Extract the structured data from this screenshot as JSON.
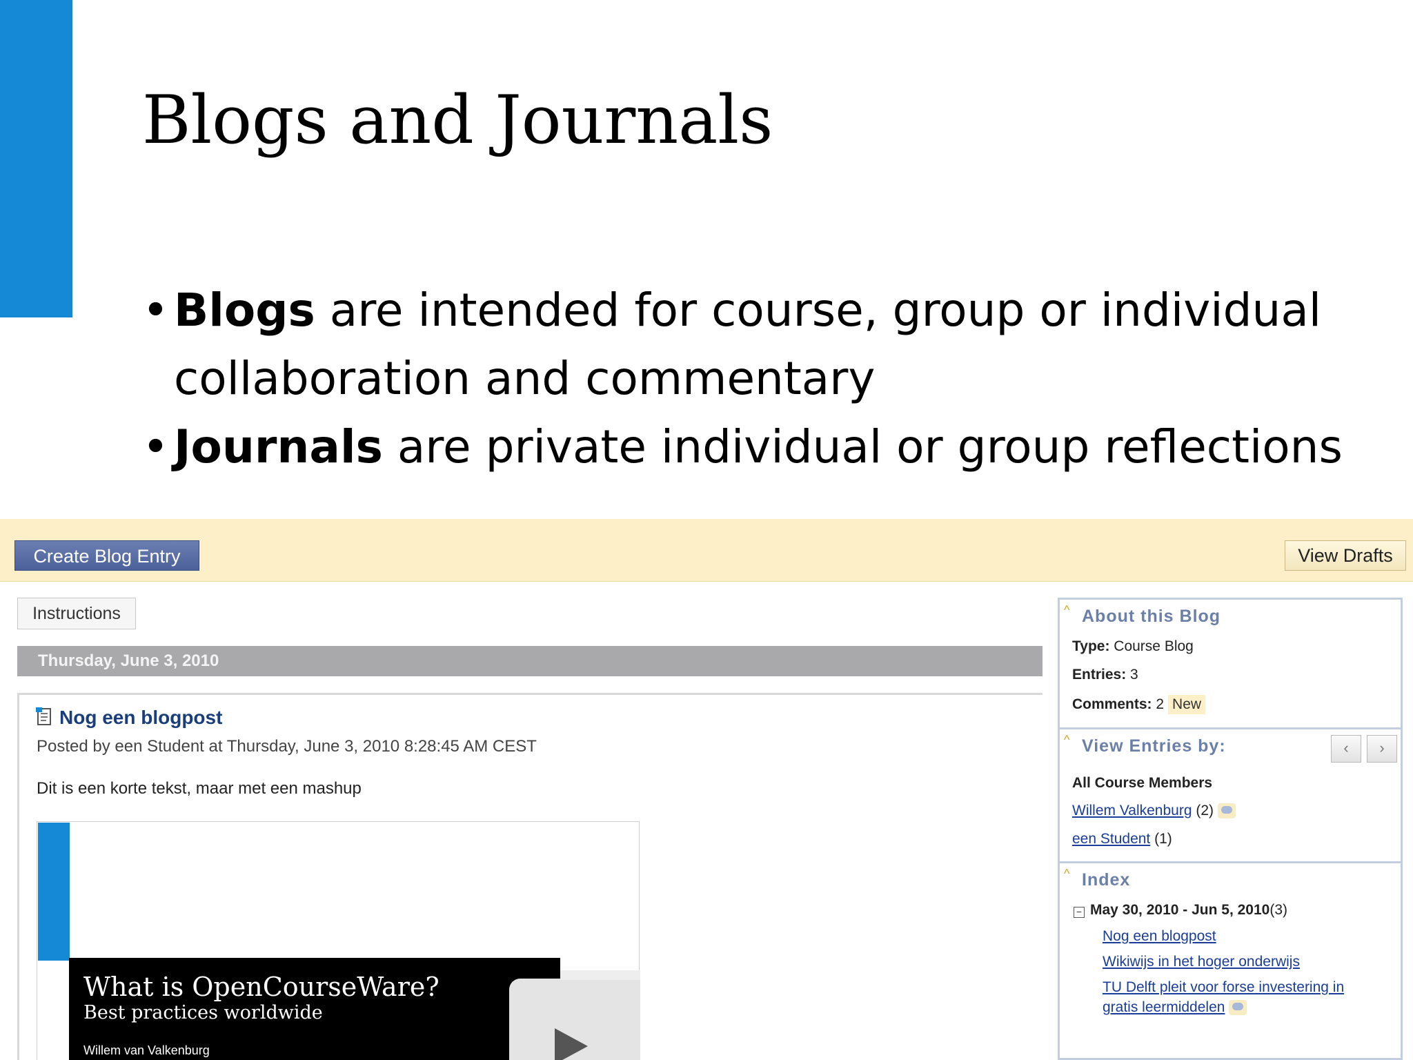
{
  "slide": {
    "title": "Blogs and Journals",
    "bullets": [
      {
        "term": "Blogs",
        "rest_line1": " are intended for course, group or individual",
        "rest_line2": "collaboration and commentary"
      },
      {
        "term": "Journals",
        "rest": " are private individual or group reflections"
      }
    ],
    "accent_color": "#1689d6"
  },
  "blog": {
    "create_button": "Create Blog Entry",
    "drafts_button": "View Drafts",
    "instructions_button": "Instructions",
    "date_heading": "Thursday, June 3, 2010",
    "entry": {
      "title": "Nog een blogpost",
      "meta": "Posted by een Student at Thursday, June 3, 2010 8:28:45 AM CEST",
      "body": "Dit is een korte tekst, maar met een mashup"
    },
    "video": {
      "title": "What is OpenCourseWare?",
      "subtitle": "Best practices worldwide",
      "author": "Willem van Valkenburg"
    },
    "about": {
      "heading": "About this Blog",
      "type_label": "Type:",
      "type_value": " Course Blog",
      "entries_label": "Entries:",
      "entries_value": " 3",
      "comments_label": "Comments:",
      "comments_value": " 2",
      "new_badge": "New"
    },
    "view_entries": {
      "heading": "View Entries by:",
      "prev": "‹",
      "next": "›",
      "all_members": "All Course Members",
      "members": [
        {
          "name": "Willem Valkenburg",
          "count": " (2)"
        },
        {
          "name": "een Student",
          "count": " (1)"
        }
      ]
    },
    "index": {
      "heading": "Index",
      "toggle": "−",
      "range": "May 30, 2010 - Jun 5, 2010",
      "range_count": "(3)",
      "links": [
        "Nog een blogpost",
        "Wikiwijs in het hoger onderwijs",
        "TU Delft pleit voor forse investering in",
        "gratis leermiddelen"
      ]
    },
    "colors": {
      "action_bar": "#fdf0c8",
      "primary_button": "#5a6ea6",
      "link": "#1a3d9c",
      "panel_heading": "#6b7fa8"
    }
  }
}
